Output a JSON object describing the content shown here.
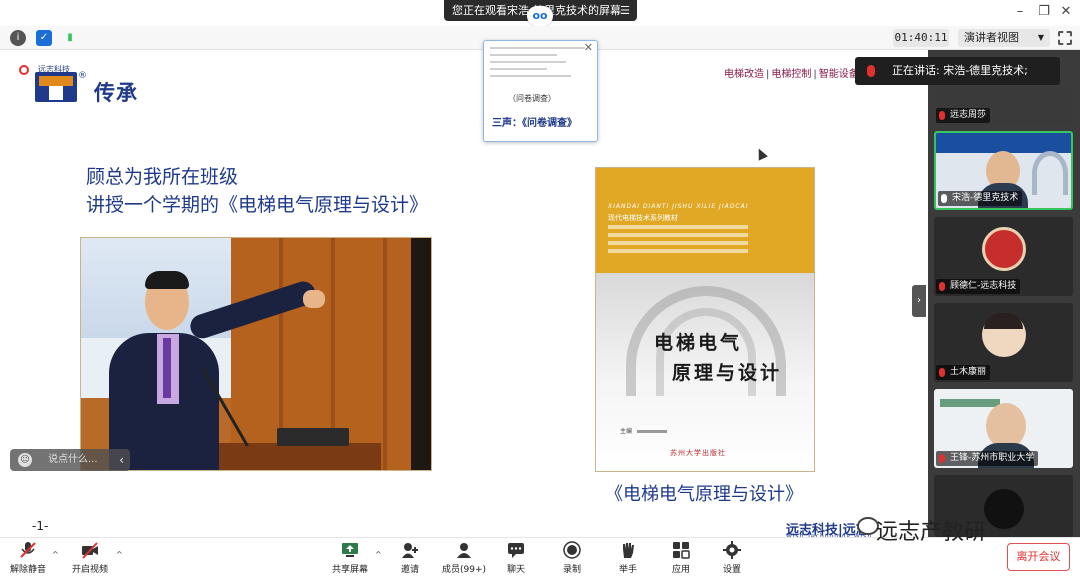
{
  "topbar": {
    "share_notice": "您正在观看宋浩-德里克技术的屏幕",
    "menu_icon": "hamburger-icon"
  },
  "toolbar": {
    "timer": "01:40:11",
    "view_mode": "演讲者视图",
    "colors": {
      "info": "#555555",
      "shield": "#1a6fd6",
      "signal": "#35c45e"
    }
  },
  "slide": {
    "logo_small": "远志科技",
    "logo_reg": "®",
    "heritage": "传承",
    "top_links": [
      "电梯改造",
      "电梯控制",
      "智能设备"
    ],
    "headline_1": "顾总为我所在班级",
    "headline_2": "讲授一个学期的《电梯电气原理与设计》",
    "book": {
      "pinyin": "XIANDAI DIANTI JISHU XILIE JIAOCAI",
      "series": "现代电梯技术系列教材",
      "title_1": "电梯电气",
      "title_2": "原理与设计",
      "author": "主编",
      "publisher": "苏州大学出版社"
    },
    "book_caption": "《电梯电气原理与设计》",
    "page_number": "-1-",
    "footer_logo": "远志科技|远志",
    "footer_logo_sub": "Wish Technology  Wish"
  },
  "popup": {
    "overlay_text": "（问卷调查）",
    "caption": "三声：《问卷调查》"
  },
  "chat": {
    "placeholder": "说点什么..."
  },
  "gallery": {
    "speaking": "正在讲话: 宋浩-德里克技术;",
    "participants": [
      {
        "name": "远志周莎"
      },
      {
        "name": "宋浩-德里克技术"
      },
      {
        "name": "顾德仁-远志科技"
      },
      {
        "name": "土木康丽"
      },
      {
        "name": "王锋-苏州市职业大学"
      }
    ]
  },
  "bottombar": {
    "items": [
      {
        "label": "解除静音",
        "icon": "mic-muted-icon"
      },
      {
        "label": "开启视频",
        "icon": "video-off-icon"
      },
      {
        "label": "共享屏幕",
        "icon": "share-screen-icon"
      },
      {
        "label": "邀请",
        "icon": "invite-icon"
      },
      {
        "label": "成员(99+)",
        "icon": "members-icon"
      },
      {
        "label": "聊天",
        "icon": "chat-icon"
      },
      {
        "label": "录制",
        "icon": "record-icon"
      },
      {
        "label": "举手",
        "icon": "raise-hand-icon"
      },
      {
        "label": "应用",
        "icon": "apps-icon"
      },
      {
        "label": "设置",
        "icon": "settings-icon"
      }
    ],
    "leave": "离开会议"
  },
  "watermark": "远志产教研"
}
